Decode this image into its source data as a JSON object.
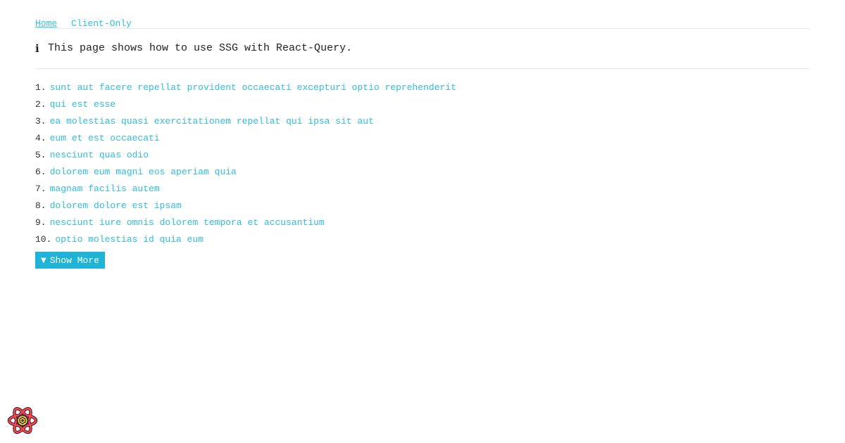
{
  "nav": {
    "home_label": "Home",
    "client_only_label": "Client-Only"
  },
  "info": {
    "icon_glyph": "i",
    "text": "This page shows how to use SSG with React-Query."
  },
  "posts": [
    {
      "number": "1.",
      "title": "sunt aut facere repellat provident occaecati excepturi optio reprehenderit"
    },
    {
      "number": "2.",
      "title": "qui est esse"
    },
    {
      "number": "3.",
      "title": "ea molestias quasi exercitationem repellat qui ipsa sit aut"
    },
    {
      "number": "4.",
      "title": "eum et est occaecati"
    },
    {
      "number": "5.",
      "title": "nesciunt quas odio"
    },
    {
      "number": "6.",
      "title": "dolorem eum magni eos aperiam quia"
    },
    {
      "number": "7.",
      "title": "magnam facilis autem"
    },
    {
      "number": "8.",
      "title": "dolorem dolore est ipsam"
    },
    {
      "number": "9.",
      "title": "nesciunt iure omnis dolorem tempora et accusantium"
    },
    {
      "number": "10.",
      "title": "optio molestias id quia eum"
    }
  ],
  "show_more": {
    "icon_glyph": "▼",
    "label": "Show More"
  },
  "devtools": {
    "icon": "react-query-devtools-logo-icon"
  },
  "colors": {
    "link": "#2dbfe0",
    "button": "#1fb4d6",
    "divider": "#e6e6e6"
  }
}
